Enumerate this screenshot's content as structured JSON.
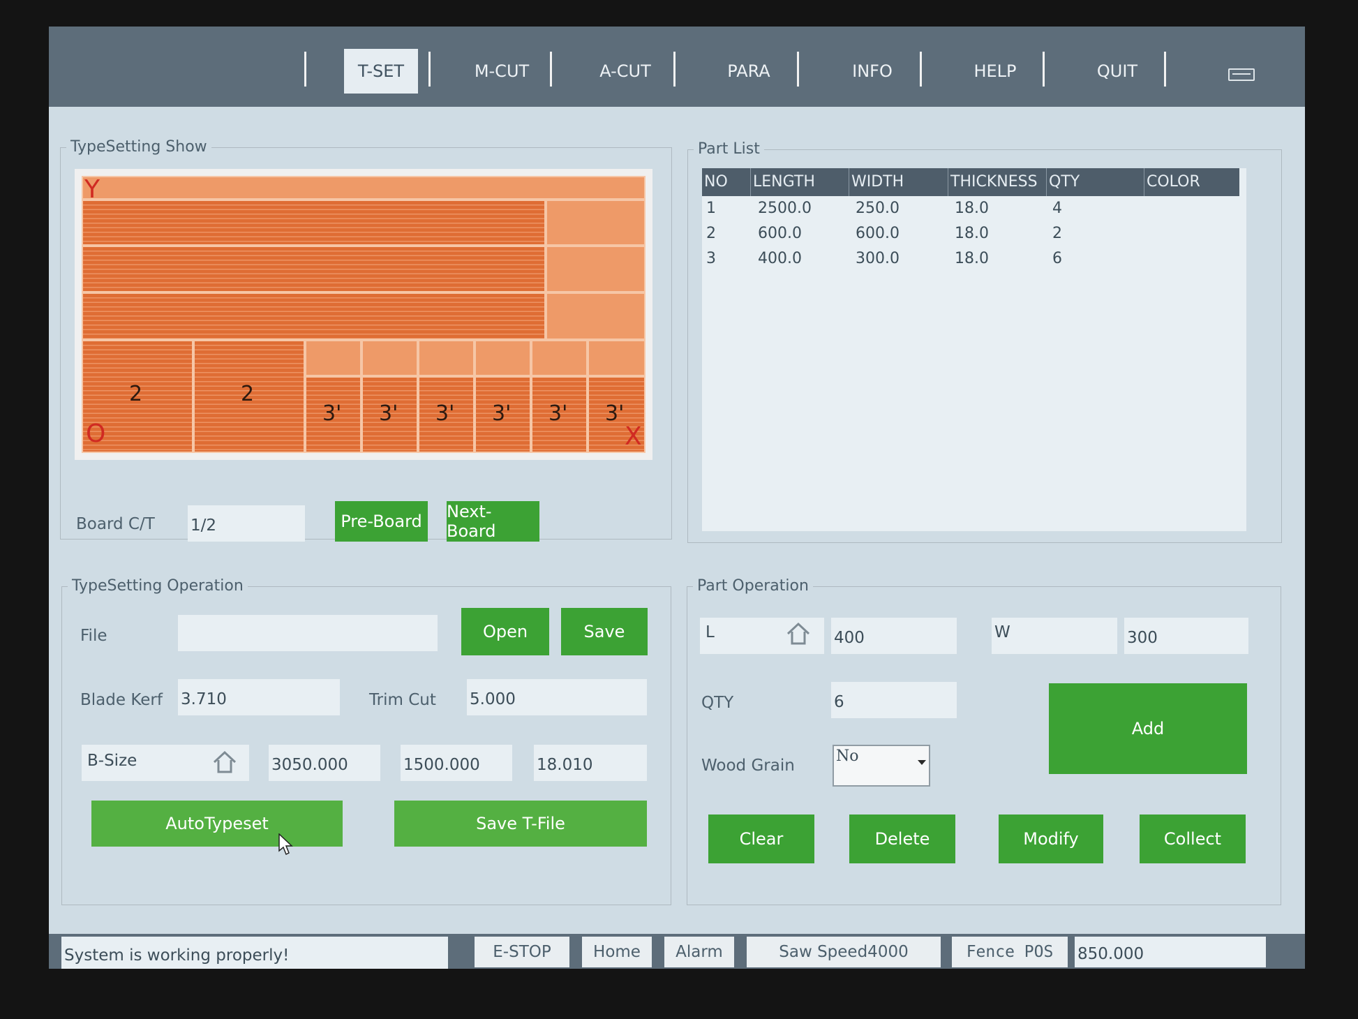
{
  "nav": {
    "tabs": [
      "T-SET",
      "M-CUT",
      "A-CUT",
      "PARA",
      "INFO",
      "HELP",
      "QUIT"
    ],
    "active": "T-SET",
    "keyboard_icon": "keyboard-icon"
  },
  "typesetting_show": {
    "title": "TypeSetting Show",
    "axis_y": "Y",
    "axis_x": "X",
    "origin": "O",
    "piece_labels": [
      "2",
      "2",
      "3'",
      "3'",
      "3'",
      "3'",
      "3'",
      "3'"
    ],
    "board_ct_label": "Board C/T",
    "board_ct_value": "1/2",
    "pre_board": "Pre-Board",
    "next_board": "Next-Board"
  },
  "part_list": {
    "title": "Part List",
    "columns": [
      "NO",
      "LENGTH",
      "WIDTH",
      "THICKNESS",
      "QTY",
      "COLOR"
    ],
    "rows": [
      {
        "no": "1",
        "length": "2500.0",
        "width": "250.0",
        "thickness": "18.0",
        "qty": "4",
        "color": ""
      },
      {
        "no": "2",
        "length": "600.0",
        "width": "600.0",
        "thickness": "18.0",
        "qty": "2",
        "color": ""
      },
      {
        "no": "3",
        "length": "400.0",
        "width": "300.0",
        "thickness": "18.0",
        "qty": "6",
        "color": ""
      }
    ]
  },
  "typesetting_operation": {
    "title": "TypeSetting Operation",
    "file_label": "File",
    "file_value": "",
    "open": "Open",
    "save": "Save",
    "blade_kerf_label": "Blade Kerf",
    "blade_kerf_value": "3.710",
    "trim_cut_label": "Trim Cut",
    "trim_cut_value": "5.000",
    "b_size_label": "B-Size",
    "b_size_length": "3050.000",
    "b_size_width": "1500.000",
    "b_size_thickness": "18.010",
    "autotypeset": "AutoTypeset",
    "save_tfile": "Save T-File"
  },
  "part_operation": {
    "title": "Part Operation",
    "l_label": "L",
    "l_value": "400",
    "w_label": "W",
    "w_value": "300",
    "qty_label": "QTY",
    "qty_value": "6",
    "wood_grain_label": "Wood Grain",
    "wood_grain_value": "No",
    "add": "Add",
    "clear": "Clear",
    "delete": "Delete",
    "modify": "Modify",
    "collect": "Collect"
  },
  "status": {
    "message": "System is working properly!",
    "estop": "E-STOP",
    "home": "Home",
    "alarm": "Alarm",
    "saw_speed": "Saw Speed4000",
    "fence_pos_label": "Fence POS",
    "fence_pos_value": "850.000"
  },
  "colors": {
    "nav_bg": "#5d6d7a",
    "screen_bg": "#cfdce4",
    "button_green": "#3ca234",
    "piece_orange": "#df6d34",
    "axis_red": "#d02a22"
  }
}
